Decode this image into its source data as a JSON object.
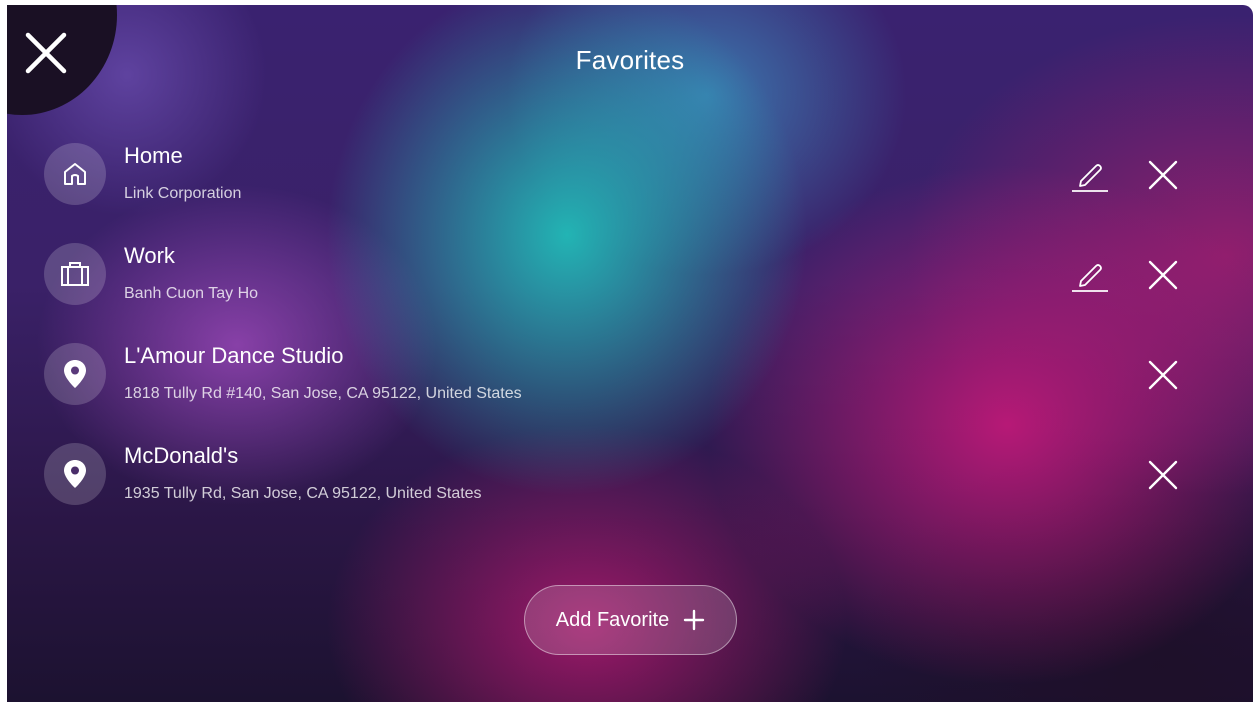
{
  "header": {
    "title": "Favorites"
  },
  "favorites": [
    {
      "name": "Home",
      "subtitle": "Link Corporation",
      "icon": "home-icon",
      "editable": true
    },
    {
      "name": "Work",
      "subtitle": "Banh Cuon Tay Ho",
      "icon": "briefcase-icon",
      "editable": true
    },
    {
      "name": "L'Amour Dance Studio",
      "subtitle": "1818 Tully Rd #140, San Jose, CA 95122, United States",
      "icon": "location-pin-icon",
      "editable": false
    },
    {
      "name": "McDonald's",
      "subtitle": "1935 Tully Rd, San Jose, CA 95122, United States",
      "icon": "location-pin-icon",
      "editable": false
    }
  ],
  "add_button": {
    "label": "Add Favorite",
    "icon": "plus-icon"
  },
  "colors": {
    "text": "#ffffff",
    "corner_button_bg": "#1a1024",
    "accent_teal": "#21bcb8",
    "accent_magenta": "#be1978"
  }
}
